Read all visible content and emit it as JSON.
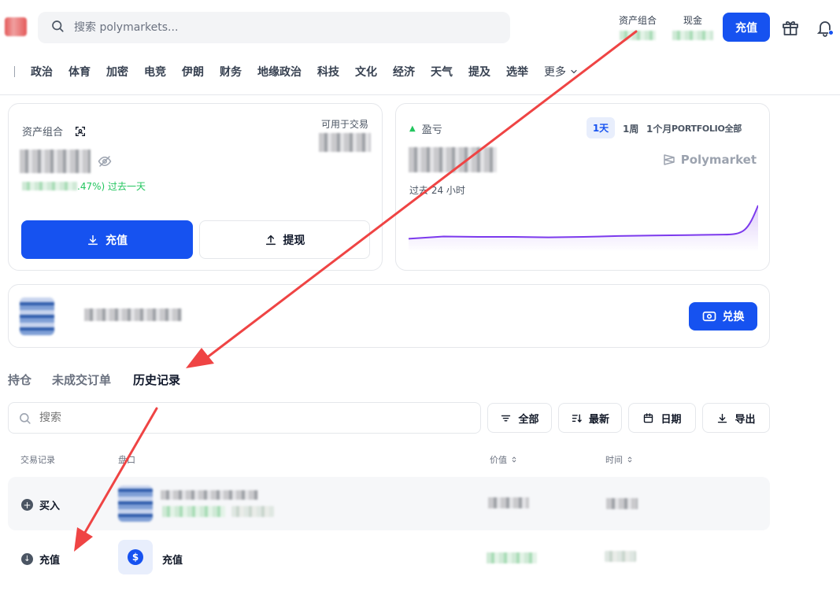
{
  "header": {
    "search_placeholder": "搜索 polymarkets...",
    "portfolio_label": "资产组合",
    "cash_label": "现金",
    "deposit_label": "充值"
  },
  "nav": {
    "items": [
      "政治",
      "体育",
      "加密",
      "电竞",
      "伊朗",
      "财务",
      "地缘政治",
      "科技",
      "文化",
      "经济",
      "天气",
      "提及",
      "选举"
    ],
    "more": "更多"
  },
  "portfolio_card": {
    "title": "资产组合",
    "available_label": "可用于交易",
    "change_text": ".47%) 过去一天",
    "deposit_label": "充值",
    "withdraw_label": "提现"
  },
  "pnl_card": {
    "title": "盈亏",
    "ranges": [
      "1天",
      "1周",
      "1个月"
    ],
    "ranges_overlap_text": "PORTFOLIO全部",
    "brand": "Polymarket",
    "period_label": "过去 24 小时",
    "chart_data": {
      "type": "area",
      "title": "",
      "x": [
        0,
        1,
        2,
        3,
        4,
        5,
        6,
        7,
        8,
        9,
        10
      ],
      "y": [
        0.27,
        0.32,
        0.31,
        0.31,
        0.3,
        0.31,
        0.33,
        0.34,
        0.35,
        0.36,
        1.0
      ],
      "color": "#7c3aed"
    }
  },
  "swap_card": {
    "swap_label": "兑换"
  },
  "tabs": [
    "持仓",
    "未成交订单",
    "历史记录"
  ],
  "active_tab": "历史记录",
  "history": {
    "search_placeholder": "搜索",
    "filters": {
      "all": "全部",
      "latest": "最新",
      "date": "日期",
      "export": "导出"
    },
    "columns": {
      "type": "交易记录",
      "market": "盘口",
      "value": "价值",
      "time": "时间"
    },
    "rows": [
      {
        "type": "买入",
        "market": ""
      },
      {
        "type": "充值",
        "market": "充值"
      }
    ]
  },
  "colors": {
    "primary": "#1652f0",
    "annotation_arrow": "#ef4444",
    "positive": "#22c55e",
    "chart_line": "#7c3aed"
  }
}
